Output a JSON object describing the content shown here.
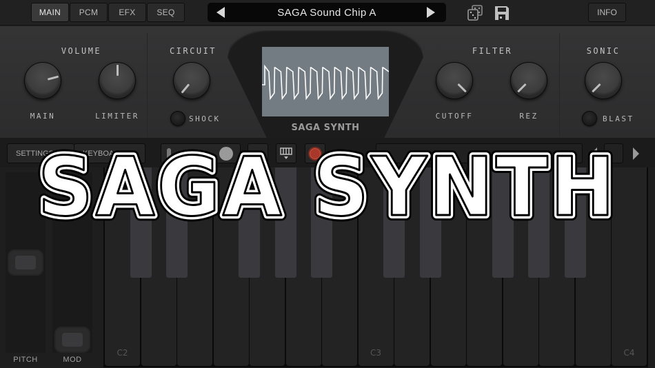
{
  "topbar": {
    "tabs": [
      {
        "label": "MAIN",
        "active": true
      },
      {
        "label": "PCM",
        "active": false
      },
      {
        "label": "EFX",
        "active": false
      },
      {
        "label": "SEQ",
        "active": false
      }
    ],
    "preset_name": "SAGA Sound Chip A",
    "icons": [
      "prev-preset-icon",
      "next-preset-icon",
      "dice-random-icon",
      "floppy-save-icon"
    ],
    "info_label": "INFO"
  },
  "panel": {
    "sections": {
      "volume": "VOLUME",
      "circuit": "CIRCUIT",
      "filter": "FILTER",
      "sonic": "SONIC"
    },
    "knobs": [
      {
        "id": "main",
        "label": "MAIN",
        "angle_deg": 75
      },
      {
        "id": "limiter",
        "label": "LIMITER",
        "angle_deg": 0
      },
      {
        "id": "circuit",
        "label": "",
        "angle_deg": -140
      },
      {
        "id": "cutoff",
        "label": "CUTOFF",
        "angle_deg": 135
      },
      {
        "id": "rez",
        "label": "REZ",
        "angle_deg": -135
      },
      {
        "id": "sonic",
        "label": "",
        "angle_deg": -135
      }
    ],
    "switches": [
      {
        "id": "shock",
        "label": "SHOCK"
      },
      {
        "id": "blast",
        "label": "BLAST"
      }
    ],
    "screen": {
      "logo": "SAGA SYNTH",
      "waveform": "square",
      "cycles": 10,
      "background": "#737b83",
      "trace_color": "#ffffff"
    }
  },
  "toolbar": {
    "settings_label": "SETTINGS",
    "keyboard_label": "KEYBOARD",
    "record_color": "#a8392a"
  },
  "sliders": {
    "pitch": {
      "label": "PITCH",
      "value": 0.5
    },
    "mod": {
      "label": "MOD",
      "value": 0.0
    }
  },
  "keyboard": {
    "octave_labels": [
      "C2",
      "C3",
      "C4"
    ],
    "white_key_count": 15
  },
  "overlay_title": "SAGA SYNTH"
}
